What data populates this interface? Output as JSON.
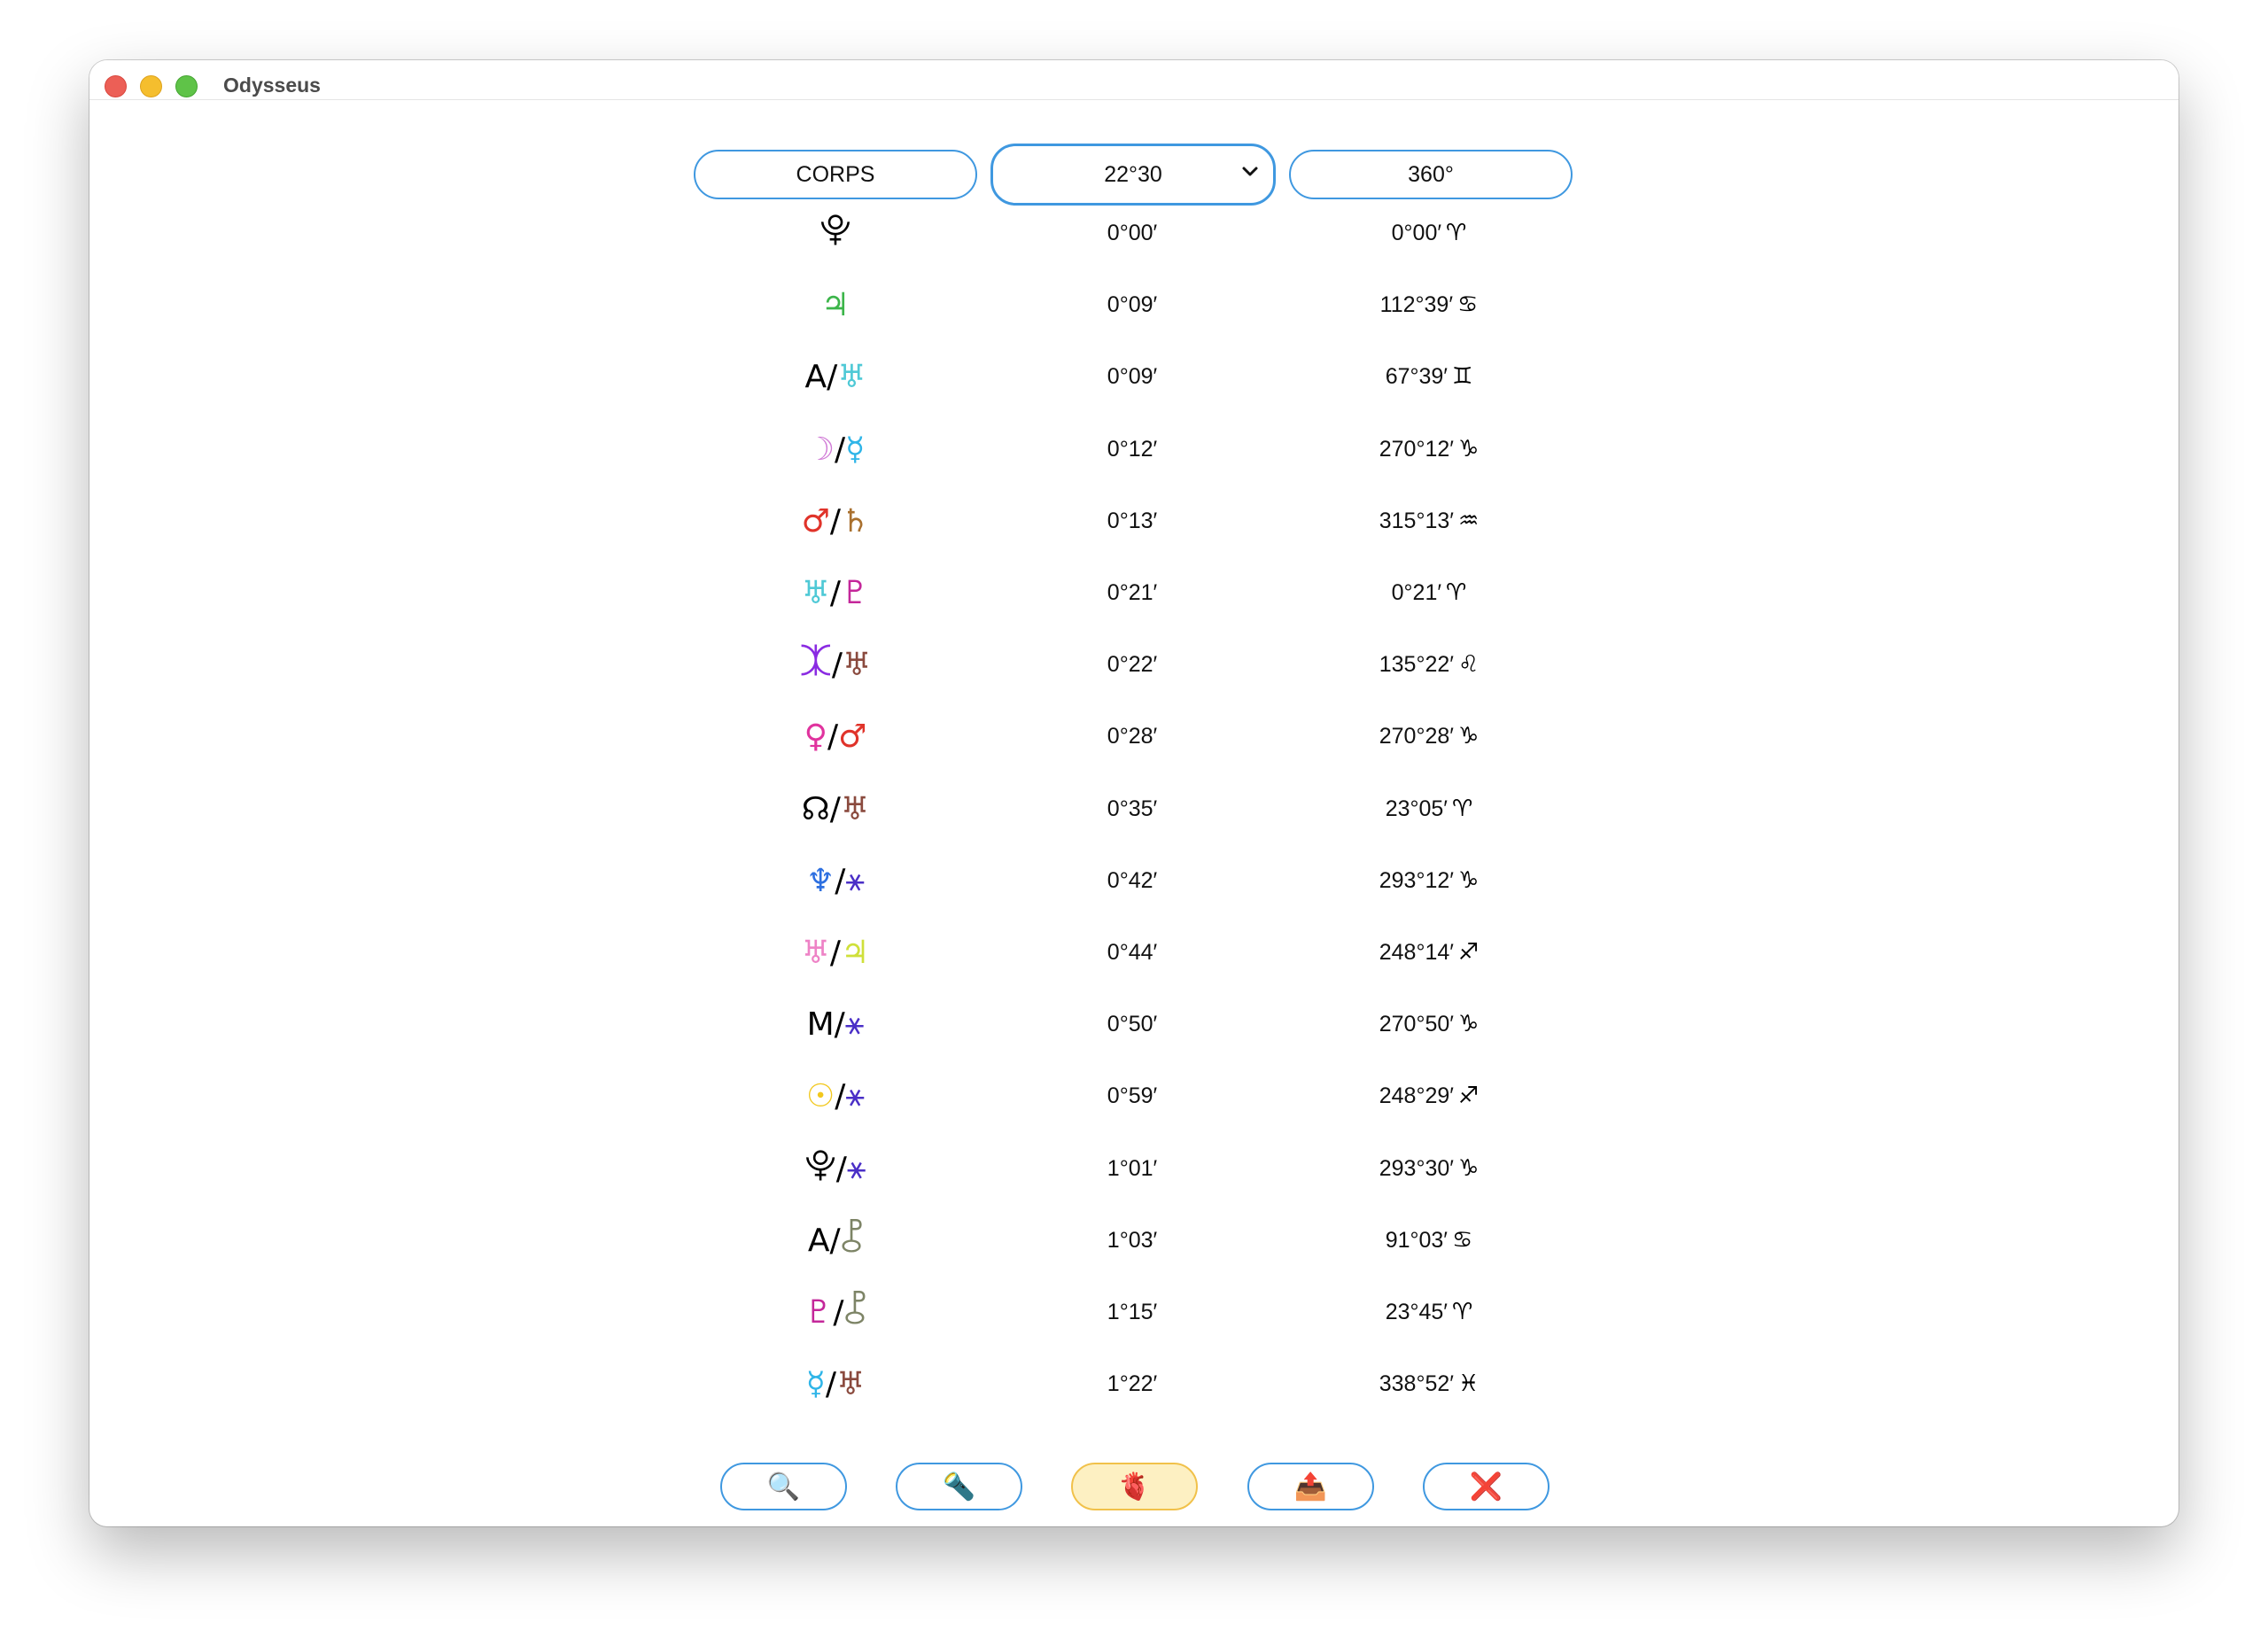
{
  "window": {
    "title": "Odysseus"
  },
  "controls": {
    "corps_label": "CORPS",
    "orb_value": "22°30",
    "range_label": "360°"
  },
  "rows": [
    {
      "p1": {
        "g": "⯓",
        "c": "#000000"
      },
      "p2": null,
      "orb": "0°00′",
      "pos": "0°00′",
      "sign": {
        "g": "♈",
        "c": "#000000"
      }
    },
    {
      "p1": {
        "g": "♃",
        "c": "#3cb54a"
      },
      "p2": null,
      "orb": "0°09′",
      "pos": "112°39′",
      "sign": {
        "g": "♋",
        "c": "#000000"
      }
    },
    {
      "p1": {
        "g": "A",
        "c": "#000000"
      },
      "p2": {
        "g": "♅",
        "c": "#4fc9d6"
      },
      "orb": "0°09′",
      "pos": "67°39′",
      "sign": {
        "g": "♊",
        "c": "#000000"
      }
    },
    {
      "p1": {
        "g": "☽",
        "c": "#d07ad6"
      },
      "p2": {
        "g": "☿",
        "c": "#2fb5e8"
      },
      "orb": "0°12′",
      "pos": "270°12′",
      "sign": {
        "g": "♑",
        "c": "#000000"
      }
    },
    {
      "p1": {
        "g": "♂",
        "c": "#e0332a"
      },
      "p2": {
        "g": "♄",
        "c": "#a9702e"
      },
      "orb": "0°13′",
      "pos": "315°13′",
      "sign": {
        "g": "♒",
        "c": "#000000"
      }
    },
    {
      "p1": {
        "g": "♅",
        "c": "#4fc9d6"
      },
      "p2": {
        "g": "♇",
        "c": "#c4279a"
      },
      "orb": "0°21′",
      "pos": "0°21′",
      "sign": {
        "g": "♈",
        "c": "#000000"
      }
    },
    {
      "p1": {
        "g": "⯰",
        "c": "#8a2be2"
      },
      "p2": {
        "g": "♅",
        "c": "#8a4a3e"
      },
      "orb": "0°22′",
      "pos": "135°22′",
      "sign": {
        "g": "♌",
        "c": "#000000"
      }
    },
    {
      "p1": {
        "g": "♀",
        "c": "#e0339e"
      },
      "p2": {
        "g": "♂",
        "c": "#e0332a"
      },
      "orb": "0°28′",
      "pos": "270°28′",
      "sign": {
        "g": "♑",
        "c": "#000000"
      }
    },
    {
      "p1": {
        "g": "☊",
        "c": "#000000"
      },
      "p2": {
        "g": "♅",
        "c": "#8a4a3e"
      },
      "orb": "0°35′",
      "pos": "23°05′",
      "sign": {
        "g": "♈",
        "c": "#000000"
      }
    },
    {
      "p1": {
        "g": "♆",
        "c": "#2d6fe0"
      },
      "p2": {
        "g": "⚹",
        "c": "#4a2fc7"
      },
      "orb": "0°42′",
      "pos": "293°12′",
      "sign": {
        "g": "♑",
        "c": "#000000"
      }
    },
    {
      "p1": {
        "g": "♅",
        "c": "#ee82c6"
      },
      "p2": {
        "g": "♃",
        "c": "#cfe03a"
      },
      "orb": "0°44′",
      "pos": "248°14′",
      "sign": {
        "g": "♐",
        "c": "#000000"
      }
    },
    {
      "p1": {
        "g": "M",
        "c": "#000000"
      },
      "p2": {
        "g": "⚹",
        "c": "#4a2fc7"
      },
      "orb": "0°50′",
      "pos": "270°50′",
      "sign": {
        "g": "♑",
        "c": "#000000"
      }
    },
    {
      "p1": {
        "g": "☉",
        "c": "#f2c81e"
      },
      "p2": {
        "g": "⚹",
        "c": "#4a2fc7"
      },
      "orb": "0°59′",
      "pos": "248°29′",
      "sign": {
        "g": "♐",
        "c": "#000000"
      }
    },
    {
      "p1": {
        "g": "⯓",
        "c": "#000000"
      },
      "p2": {
        "g": "⚹",
        "c": "#4a2fc7"
      },
      "orb": "1°01′",
      "pos": "293°30′",
      "sign": {
        "g": "♑",
        "c": "#000000"
      }
    },
    {
      "p1": {
        "g": "A",
        "c": "#000000"
      },
      "p2": {
        "g": "⯛",
        "c": "#7d8466"
      },
      "orb": "1°03′",
      "pos": "91°03′",
      "sign": {
        "g": "♋",
        "c": "#000000"
      }
    },
    {
      "p1": {
        "g": "♇",
        "c": "#c4279a"
      },
      "p2": {
        "g": "⯛",
        "c": "#7d8466"
      },
      "orb": "1°15′",
      "pos": "23°45′",
      "sign": {
        "g": "♈",
        "c": "#000000"
      }
    },
    {
      "p1": {
        "g": "☿",
        "c": "#2fb5e8"
      },
      "p2": {
        "g": "♅",
        "c": "#8a4a3e"
      },
      "orb": "1°22′",
      "pos": "338°52′",
      "sign": {
        "g": "♓",
        "c": "#000000"
      }
    }
  ],
  "toolbar": [
    {
      "icon": "🔍",
      "name": "search-icon",
      "active": false
    },
    {
      "icon": "🔦",
      "name": "flashlight-icon",
      "active": false
    },
    {
      "icon": "🫀",
      "name": "anatomical-heart-icon",
      "active": true
    },
    {
      "icon": "📤",
      "name": "outbox-tray-icon",
      "active": false
    },
    {
      "icon": "❌",
      "name": "cross-mark-icon",
      "active": false
    }
  ],
  "colors": {
    "accent": "#3f98e0",
    "active_fill": "#fdf0c2",
    "active_border": "#f1c14a"
  }
}
